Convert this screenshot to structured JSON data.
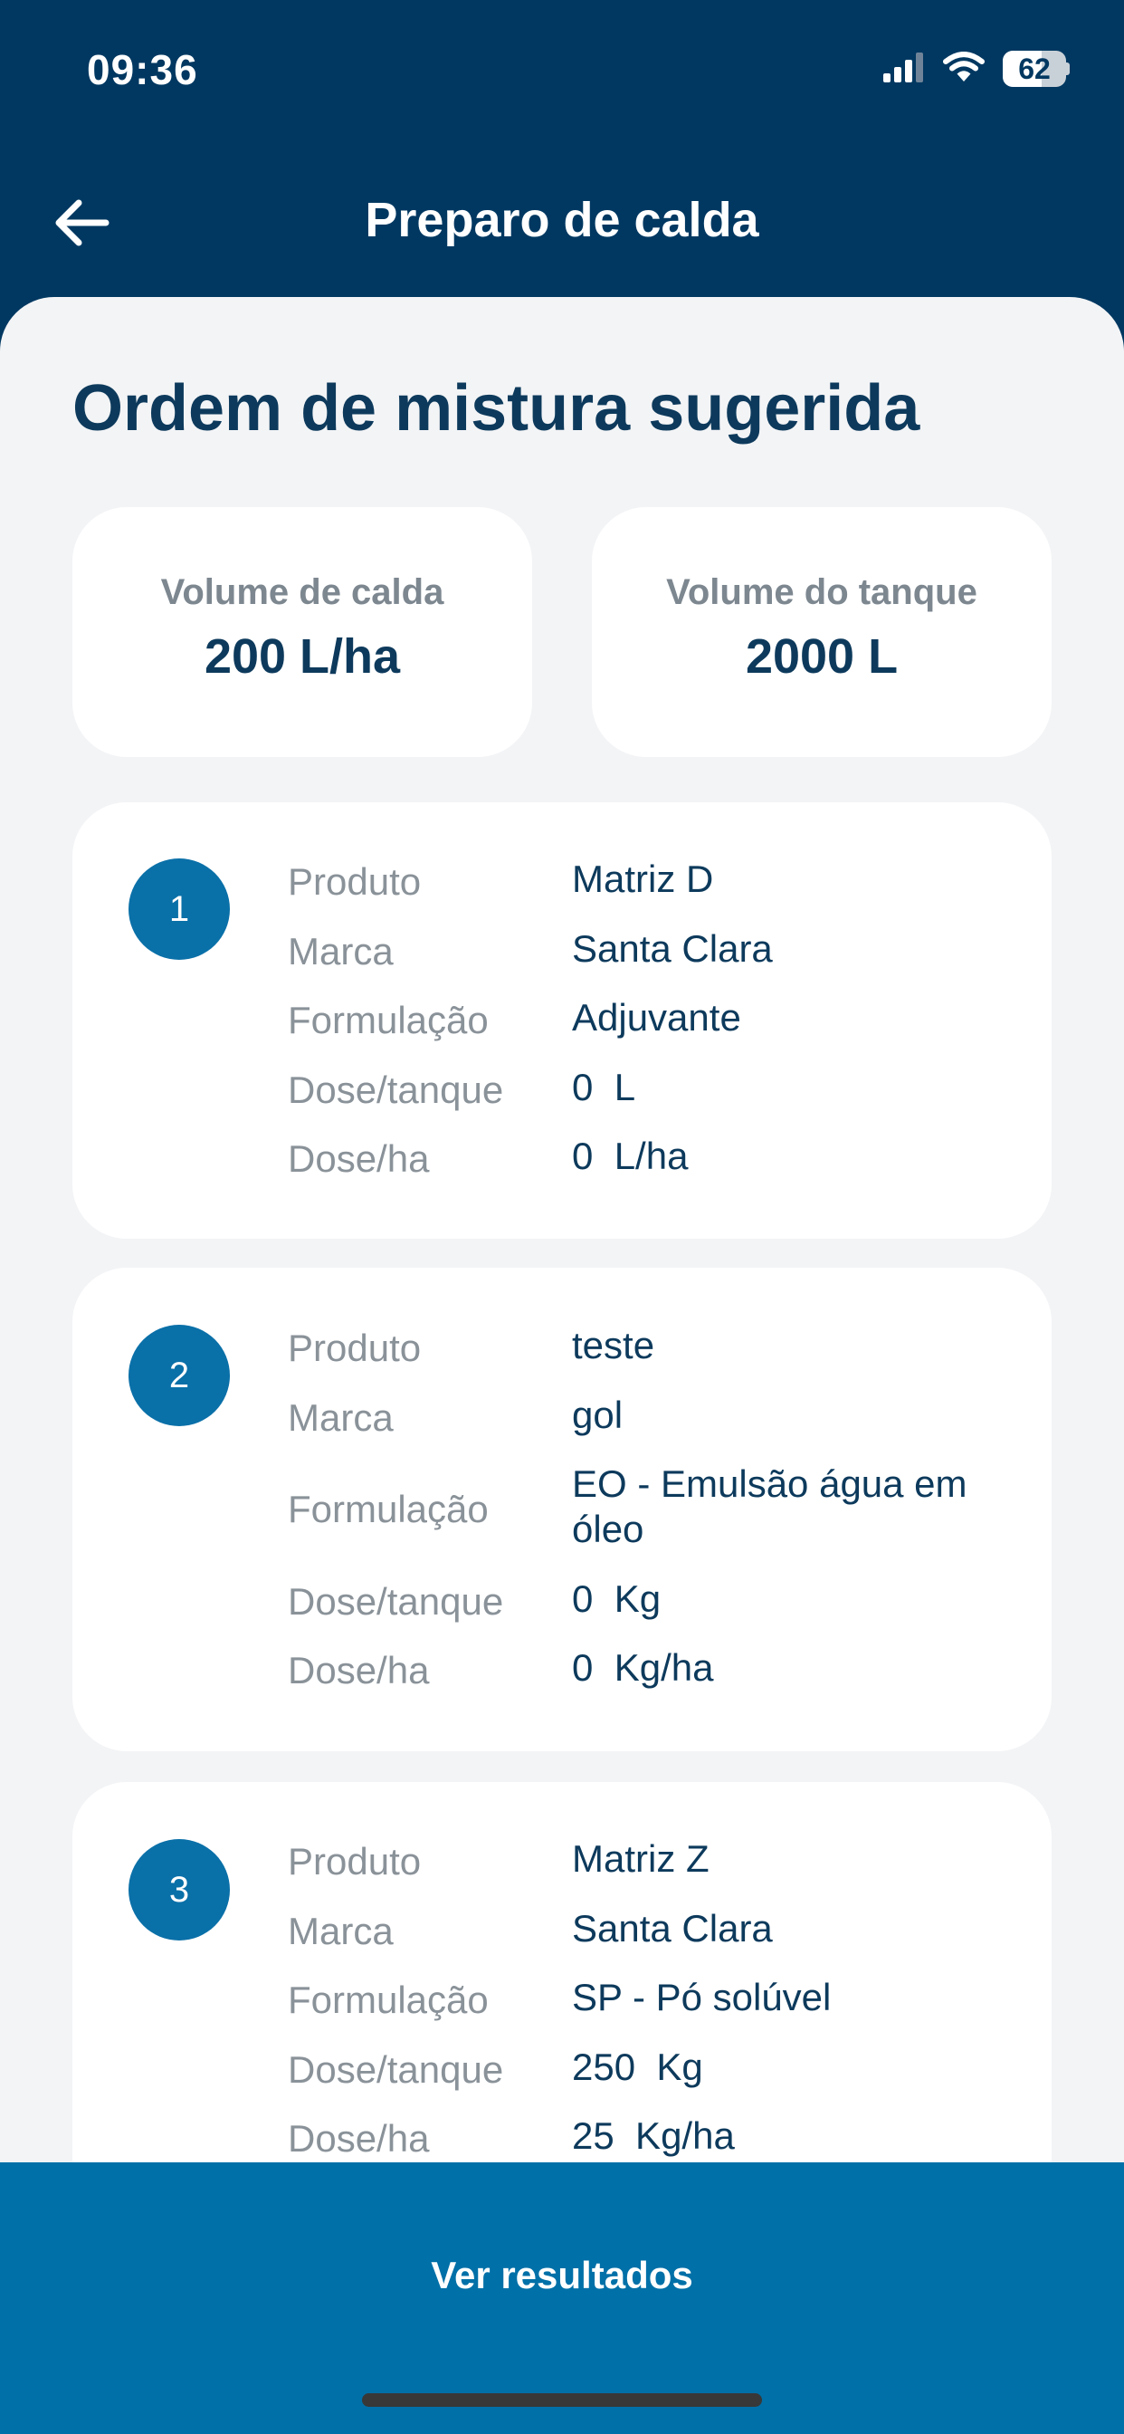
{
  "status": {
    "time": "09:36",
    "battery_level": "62",
    "battery_fraction": 0.62
  },
  "header": {
    "title": "Preparo de calda"
  },
  "main": {
    "section_title": "Ordem de mistura sugerida",
    "volumes": [
      {
        "label": "Volume de calda",
        "value": "200 L/ha"
      },
      {
        "label": "Volume do tanque",
        "value": "2000 L"
      }
    ],
    "products": [
      {
        "number": "1",
        "fields": [
          {
            "label": "Produto",
            "value": "Matriz D"
          },
          {
            "label": "Marca",
            "value": "Santa Clara"
          },
          {
            "label": "Formulação",
            "value": "Adjuvante"
          },
          {
            "label": "Dose/tanque",
            "value": "0  L"
          },
          {
            "label": "Dose/ha",
            "value": "0  L/ha"
          }
        ]
      },
      {
        "number": "2",
        "fields": [
          {
            "label": "Produto",
            "value": "teste"
          },
          {
            "label": "Marca",
            "value": "gol"
          },
          {
            "label": "Formulação",
            "value": "EO - Emulsão água em óleo"
          },
          {
            "label": "Dose/tanque",
            "value": "0  Kg"
          },
          {
            "label": "Dose/ha",
            "value": "0  Kg/ha"
          }
        ]
      },
      {
        "number": "3",
        "fields": [
          {
            "label": "Produto",
            "value": "Matriz Z"
          },
          {
            "label": "Marca",
            "value": "Santa Clara"
          },
          {
            "label": "Formulação",
            "value": "SP - Pó solúvel"
          },
          {
            "label": "Dose/tanque",
            "value": "250  Kg"
          },
          {
            "label": "Dose/ha",
            "value": "25  Kg/ha"
          }
        ]
      }
    ]
  },
  "footer": {
    "button_label": "Ver resultados"
  },
  "icons": {
    "back": "arrow-left-icon",
    "signal": "cellular-signal-icon",
    "wifi": "wifi-icon",
    "battery": "battery-icon"
  },
  "colors": {
    "header_bg": "#003861",
    "content_bg": "#f3f4f6",
    "accent": "#0a70a8",
    "bottom_bar": "#0070a8",
    "title_text": "#0d3a5c",
    "label_text": "#8a9299"
  }
}
